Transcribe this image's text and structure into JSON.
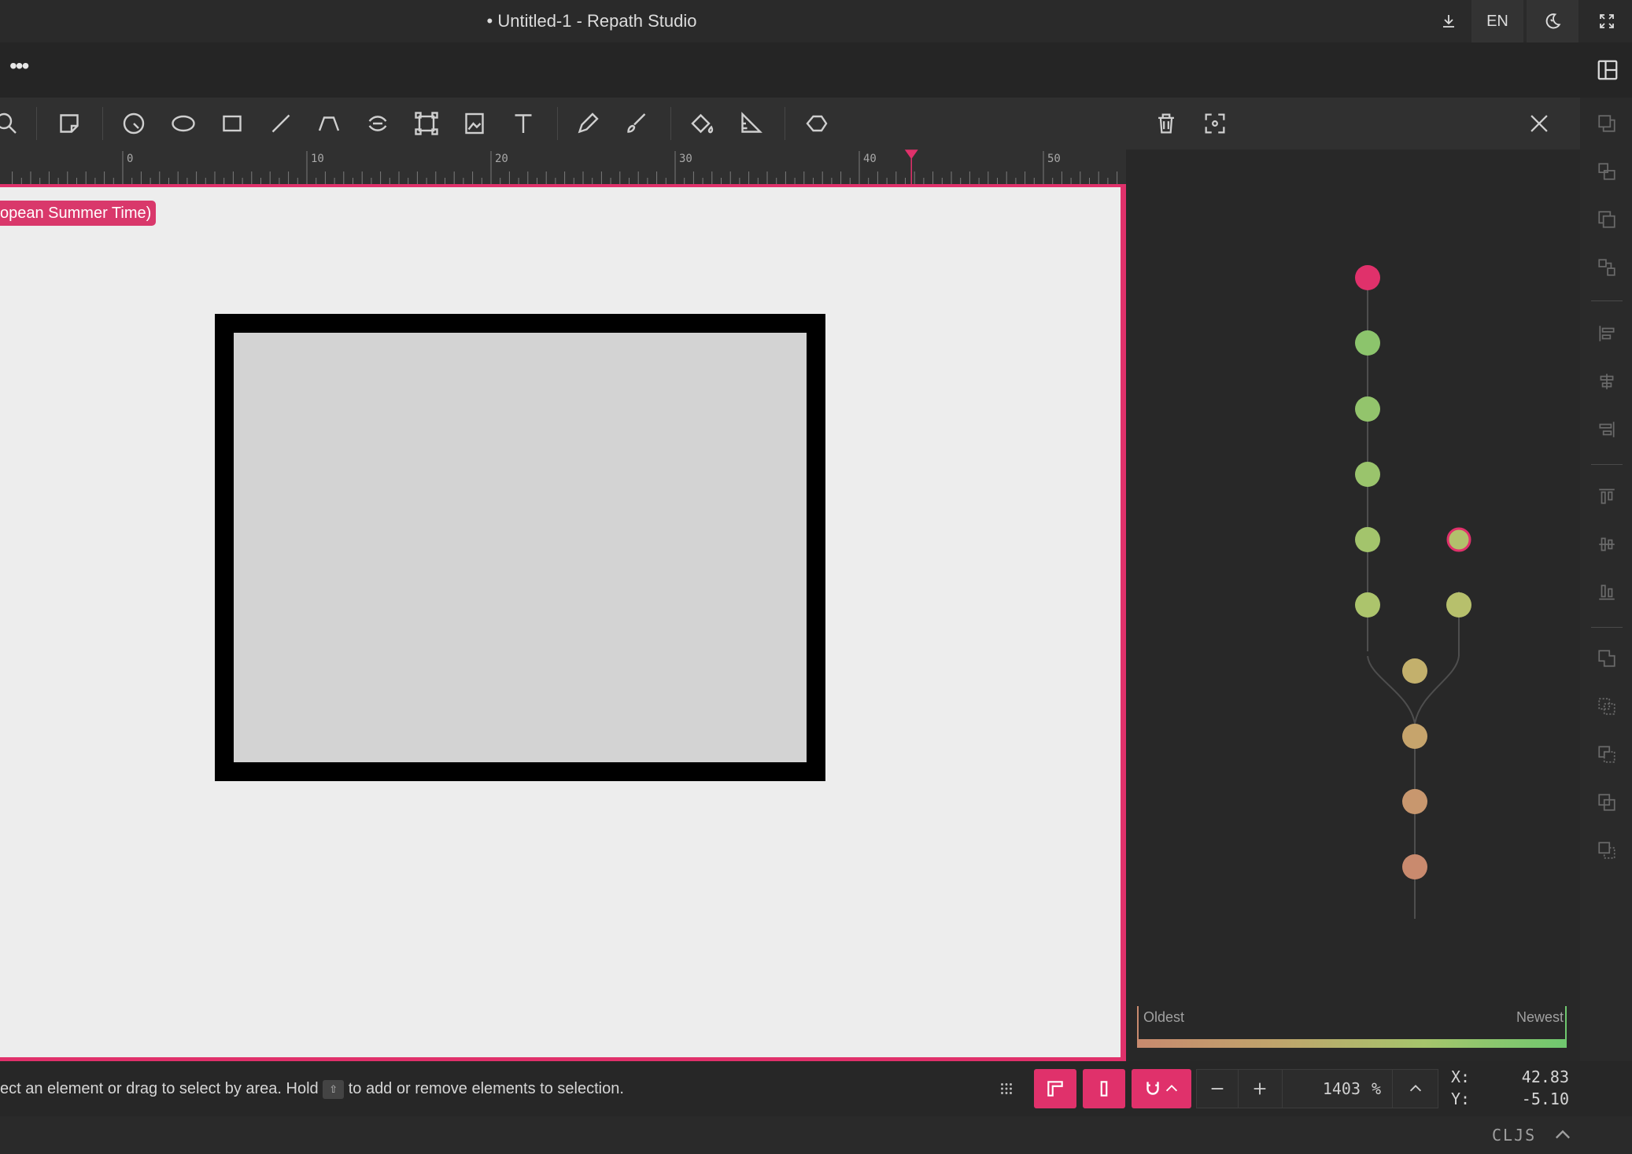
{
  "window": {
    "title": "• Untitled-1 - Repath Studio"
  },
  "titlebar": {
    "language": "EN"
  },
  "menu": {
    "more": "•••"
  },
  "ruler": {
    "labels": [
      "0",
      "10",
      "20",
      "30",
      "40",
      "50"
    ],
    "marker_value": 42.83
  },
  "canvas": {
    "time_badge": "opean Summer Time)",
    "accent_color": "#e0316b",
    "rect": {
      "fill": "#d3d3d3",
      "stroke": "#000000"
    }
  },
  "history": {
    "legend_oldest": "Oldest",
    "legend_newest": "Newest",
    "node_colors": {
      "current": "#e0316b",
      "newest": "#8cc46c",
      "oldest": "#c98a6e"
    }
  },
  "status": {
    "message_before": "ect an element or drag to select by area. Hold",
    "key": "⇧",
    "message_after": "to add or remove elements to selection.",
    "zoom_value": "1403",
    "zoom_unit": "%",
    "x_label": "X:",
    "x_value": "42.83",
    "y_label": "Y:",
    "y_value": "-5.10"
  },
  "footer": {
    "repl_mode": "CLJS"
  },
  "icons": {
    "titlebar": [
      "download-icon",
      "theme-icon",
      "fullscreen-icon"
    ],
    "toolbar": [
      "zoom-icon",
      "edit-icon",
      "circle-icon",
      "ellipse-icon",
      "rect-icon",
      "line-icon",
      "polyline-icon",
      "polygon-icon",
      "transform-icon",
      "image-icon",
      "text-icon",
      "pencil-icon",
      "brush-icon",
      "fill-icon",
      "measure-icon",
      "blob-icon"
    ],
    "history": [
      "trash-icon",
      "focus-icon",
      "close-icon"
    ]
  }
}
